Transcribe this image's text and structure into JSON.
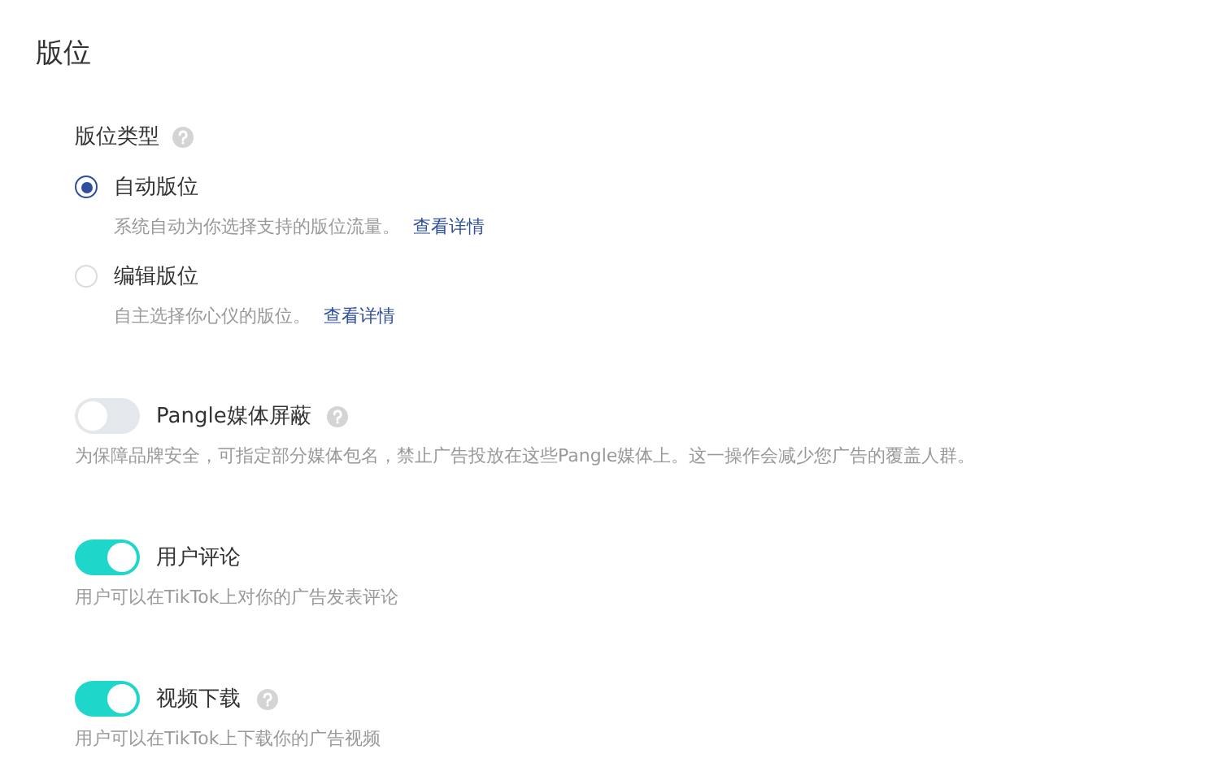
{
  "title": "版位",
  "placement_type": {
    "label": "版位类型",
    "help": true,
    "options": [
      {
        "label": "自动版位",
        "selected": true,
        "description": "系统自动为你选择支持的版位流量。",
        "link": "查看详情"
      },
      {
        "label": "编辑版位",
        "selected": false,
        "description": "自主选择你心仪的版位。",
        "link": "查看详情"
      }
    ]
  },
  "settings": [
    {
      "label": "Pangle媒体屏蔽",
      "on": false,
      "help": true,
      "description": "为保障品牌安全，可指定部分媒体包名，禁止广告投放在这些Pangle媒体上。这一操作会减少您广告的覆盖人群。"
    },
    {
      "label": "用户评论",
      "on": true,
      "help": false,
      "description": "用户可以在TikTok上对你的广告发表评论"
    },
    {
      "label": "视频下载",
      "on": true,
      "help": true,
      "description": "用户可以在TikTok上下载你的广告视频"
    }
  ]
}
